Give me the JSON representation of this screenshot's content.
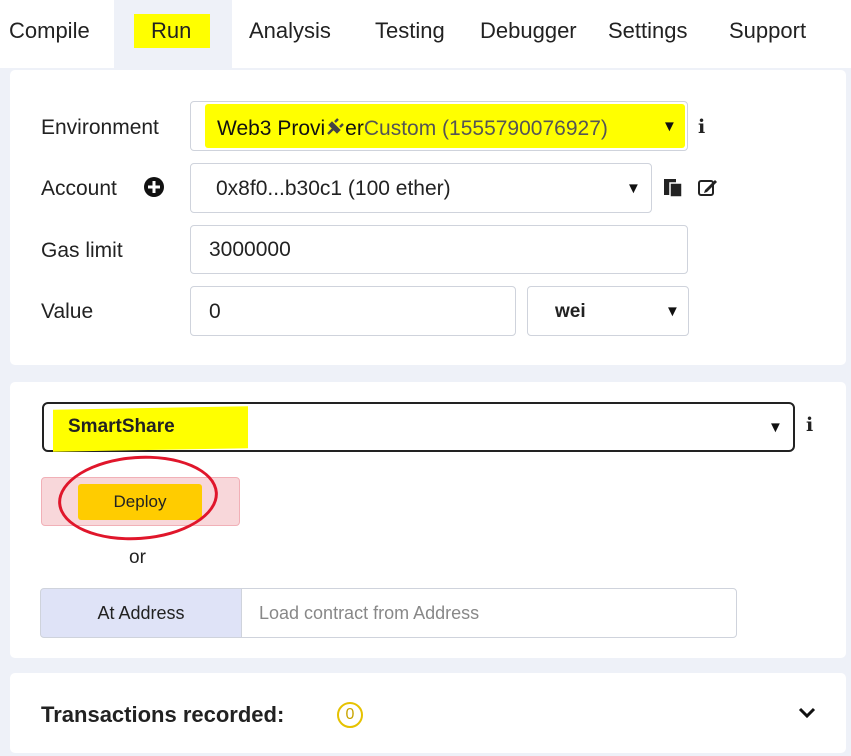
{
  "tabs": {
    "compile": "Compile",
    "run": "Run",
    "analysis": "Analysis",
    "testing": "Testing",
    "debugger": "Debugger",
    "settings": "Settings",
    "support": "Support"
  },
  "settings_panel": {
    "environment_label": "Environment",
    "environment_value_a": "Web3 Provi",
    "environment_value_b": "er",
    "environment_value_c": "Custom (1555790076927)",
    "account_label": "Account",
    "account_value": "0x8f0...b30c1 (100 ether)",
    "gas_limit_label": "Gas limit",
    "gas_limit_value": "3000000",
    "value_label": "Value",
    "value_value": "0",
    "value_unit": "wei"
  },
  "contract_panel": {
    "contract_selected": "SmartShare",
    "deploy_label": "Deploy",
    "or_text": "or",
    "at_address_label": "At Address",
    "at_address_placeholder": "Load contract from Address"
  },
  "transactions": {
    "label": "Transactions recorded:",
    "count": "0"
  },
  "colors": {
    "highlight": "#ffff00",
    "deploy_button": "#ffcc00",
    "deploy_area": "#f8d7da",
    "annotation_circle": "#e0162b",
    "at_address_button": "#dfe3f7"
  }
}
